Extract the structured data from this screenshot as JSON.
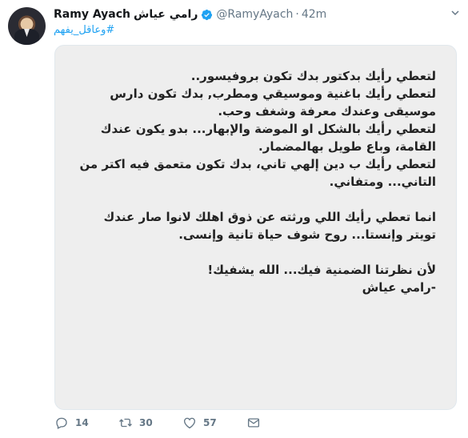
{
  "tweet": {
    "author_name": "Ramy Ayach",
    "author_name_arabic": "رامي عياش",
    "handle": "@RamyAyach",
    "separator": "·",
    "time": "42m",
    "hashtag": "#وعاقل_يفهم",
    "body": "لتعطي رأيك بدكتور بدك تكون بروفيسور..\nلتعطي رأيك باغنية وموسيقي ومطرب, بدك تكون دارس موسيقى وعندك معرفة وشغف وحب.\nلتعطي رأيك بالشكل او الموضة والإبهار... بدو يكون عندك القامة، وباع طويل بهالمضمار.\nلتعطي رأيك ب دين إلهي تاني، بدك تكون متعمق فيه اكتر من التاني... ومتفاني.\n\nانما تعطي رأيك اللي ورثته عن ذوق اهلك لانوا صار عندك تويتر وإنستا... روح شوف حياة تانية وإنسى.\n\nلأن نظرتنا الضمنية فيك... الله يشفيك!\n-رامي عياش",
    "counts": {
      "replies": "14",
      "retweets": "30",
      "likes": "57"
    }
  },
  "colors": {
    "link": "#1da1f2",
    "verified": "#1da1f2",
    "muted": "#657786",
    "card_bg": "#eeeeee"
  },
  "icons": [
    "verified-icon",
    "chevron-down-icon",
    "reply-icon",
    "retweet-icon",
    "like-icon",
    "direct-message-icon"
  ]
}
